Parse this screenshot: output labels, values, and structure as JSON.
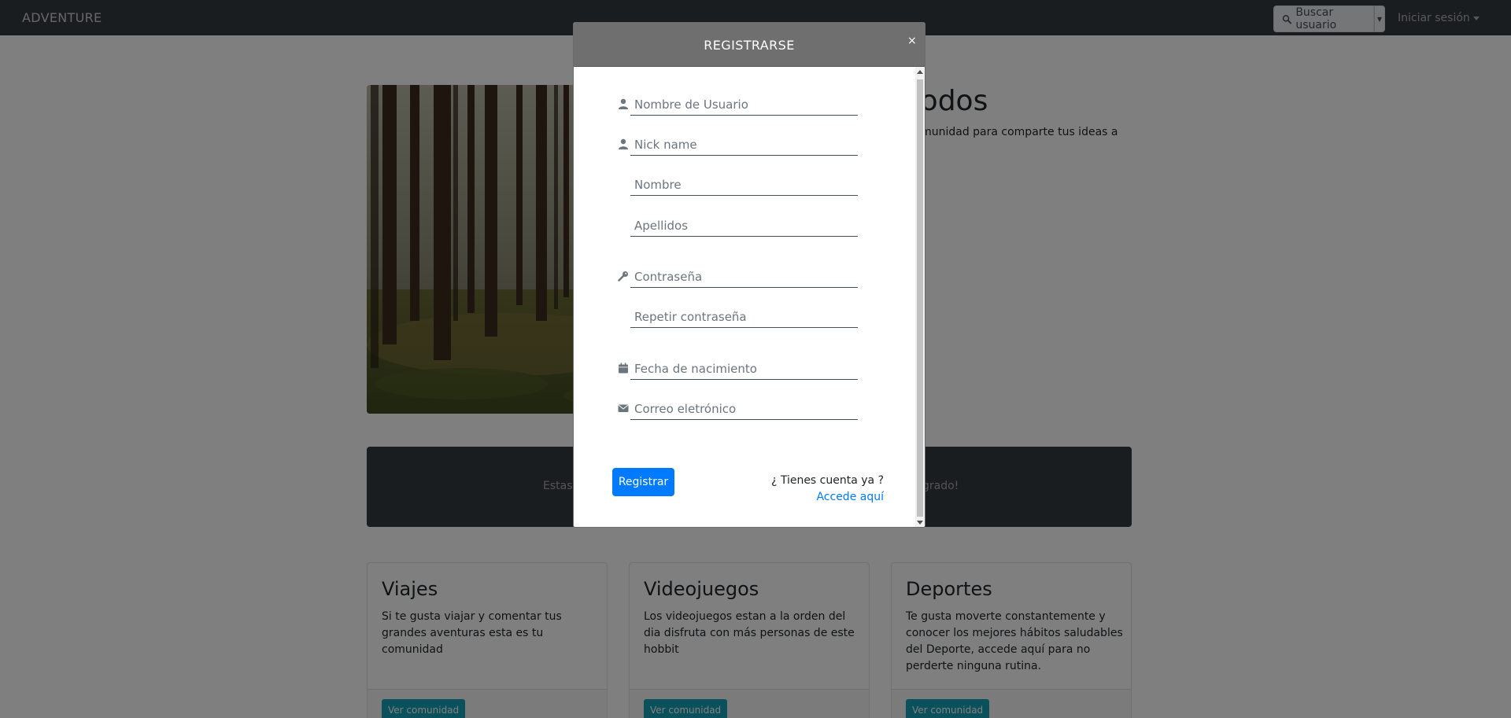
{
  "navbar": {
    "brand": "ADVENTURE",
    "search_label": "Buscar usuario",
    "login_label": "Iniciar sesión"
  },
  "hero": {
    "title": "es para todos",
    "text": "s formar parte de la comunidad para comparte tus ideas a con todos nosotros"
  },
  "banner": {
    "text_left": "Estas s",
    "text_right": "grado!"
  },
  "cards": [
    {
      "title": "Viajes",
      "text": "Si te gusta viajar y comentar tus grandes aventuras esta es tu comunidad",
      "button": "Ver comunidad"
    },
    {
      "title": "Videojuegos",
      "text": "Los videojuegos estan a la orden del dia disfruta con más personas de este hobbit",
      "button": "Ver comunidad"
    },
    {
      "title": "Deportes",
      "text": "Te gusta moverte constantemente y conocer los mejores hábitos saludables del Deporte, accede aquí para no perderte ninguna rutina.",
      "button": "Ver comunidad"
    }
  ],
  "modal": {
    "title": "REGISTRARSE",
    "close": "×",
    "fields": {
      "username": {
        "placeholder": "Nombre de Usuario",
        "icon": "user-icon"
      },
      "nickname": {
        "placeholder": "Nick name",
        "icon": "user-icon"
      },
      "first_name": {
        "placeholder": "Nombre"
      },
      "last_name": {
        "placeholder": "Apellidos"
      },
      "password": {
        "placeholder": "Contraseña",
        "icon": "key-icon"
      },
      "password_repeat": {
        "placeholder": "Repetir contraseña"
      },
      "birthdate": {
        "placeholder": "Fecha de nacimiento",
        "icon": "calendar-icon"
      },
      "email": {
        "placeholder": "Correo eletrónico",
        "icon": "envelope-icon"
      }
    },
    "register_button": "Registrar",
    "account_question": "¿ Tienes cuenta ya ?",
    "account_link": "Accede aquí"
  },
  "colors": {
    "navbar_bg": "#343a40",
    "primary": "#007bff",
    "info": "#17a2b8",
    "modal_header": "#6f6f6f"
  }
}
